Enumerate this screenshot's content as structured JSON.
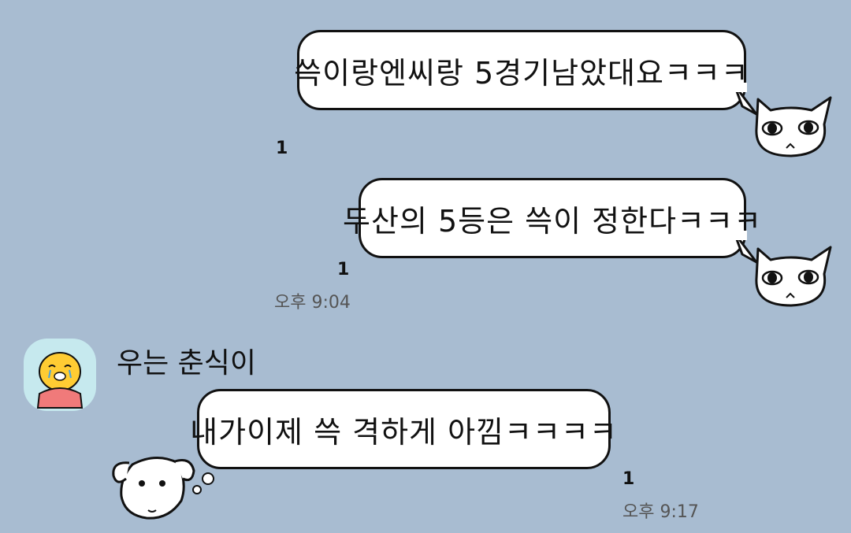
{
  "messages": [
    {
      "text": "쓱이랑엔씨랑 5경기남았대요ㅋㅋㅋ",
      "unread": "1"
    },
    {
      "text": "두산의 5등은 쓱이 정한다ㅋㅋㅋ",
      "unread": "1",
      "time": "오후 9:04"
    },
    {
      "sender": "우는 춘식이",
      "text": "내가이제 쓱 격하게 아낌ㅋㅋㅋㅋ",
      "unread": "1",
      "time": "오후 9:17"
    }
  ],
  "colors": {
    "background": "#a8bcd1",
    "bubble": "#ffffff",
    "avatar_bg": "#c6e9ee"
  }
}
